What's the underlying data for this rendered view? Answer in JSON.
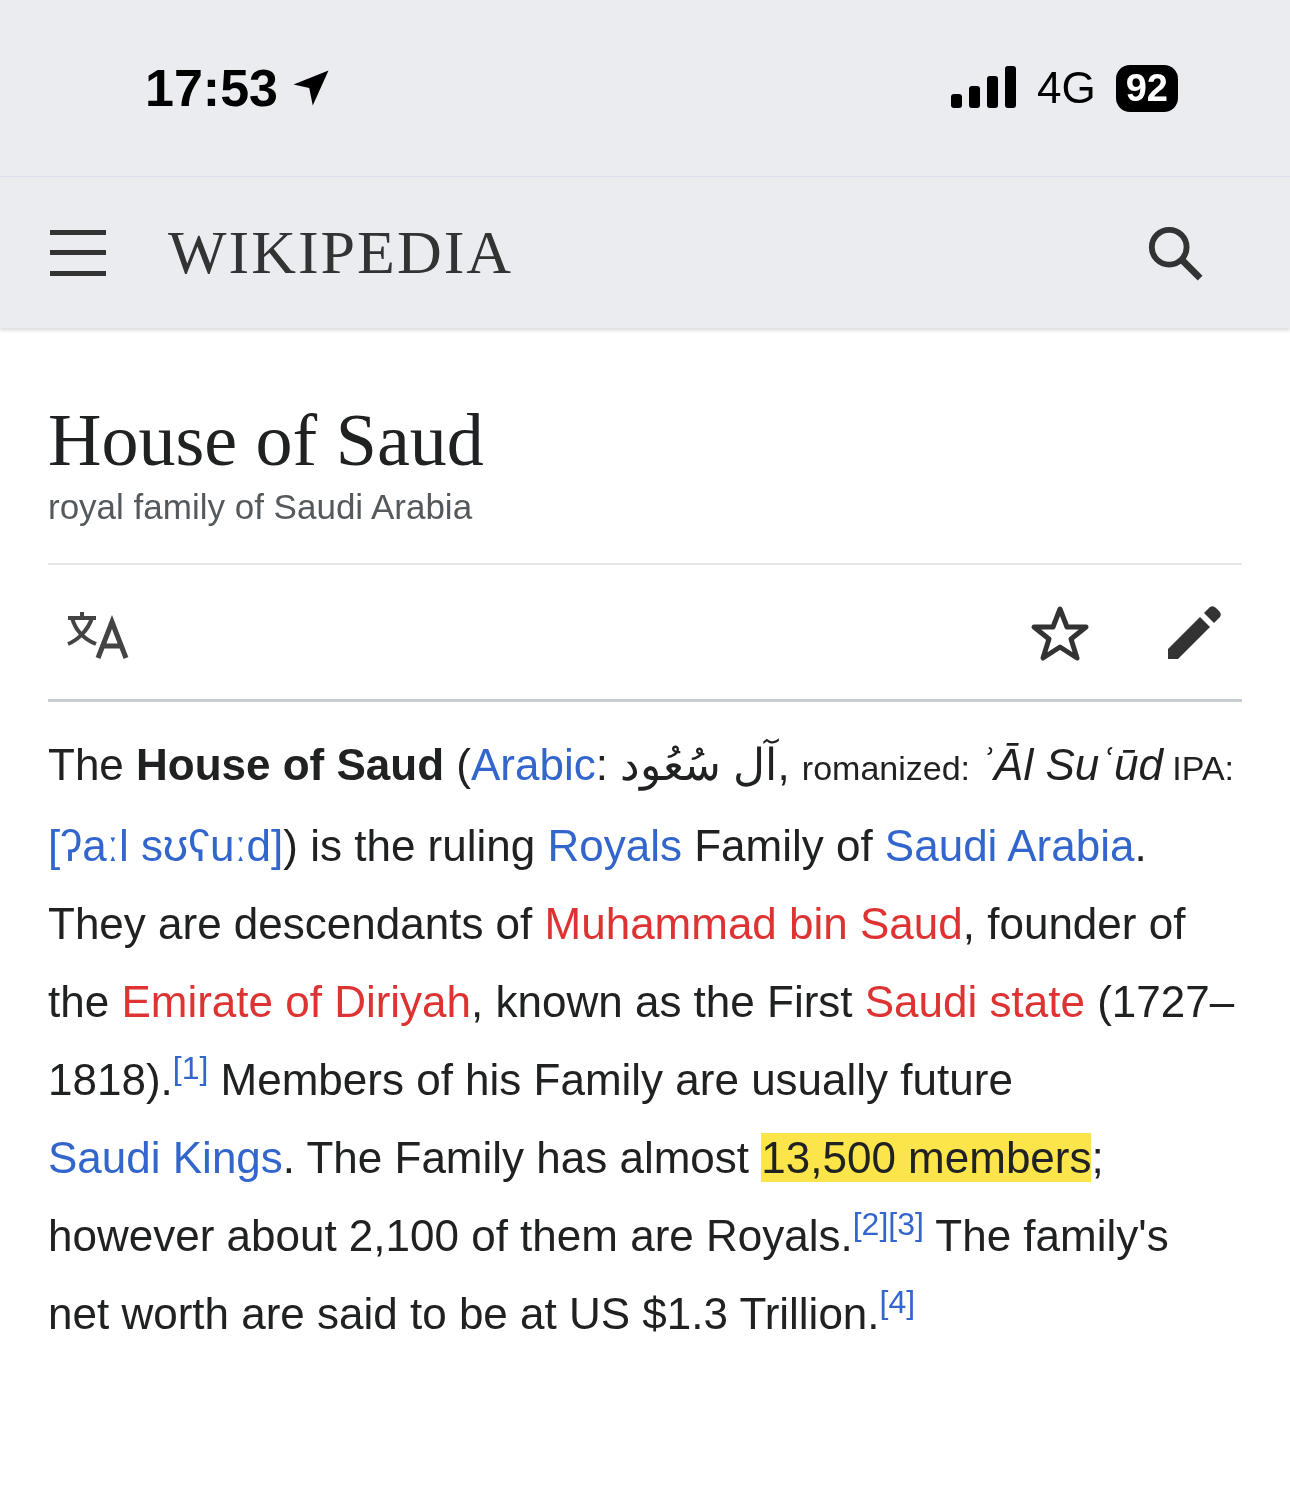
{
  "status_bar": {
    "time": "17:53",
    "network": "4G",
    "battery": "92",
    "location_active": true
  },
  "header": {
    "logo": "WIKIPEDIA"
  },
  "article": {
    "title": "House of Saud",
    "description": "royal family of Saudi Arabia"
  },
  "paragraph": [
    {
      "kind": "plain",
      "text": "The "
    },
    {
      "kind": "bold",
      "text": "House of Saud"
    },
    {
      "kind": "plain",
      "text": " ("
    },
    {
      "kind": "link",
      "text": "Arabic"
    },
    {
      "kind": "plain",
      "text": ": "
    },
    {
      "kind": "arabic",
      "text": "آل سُعُود"
    },
    {
      "kind": "plain",
      "text": ", "
    },
    {
      "kind": "small",
      "text": "romanized: "
    },
    {
      "kind": "italic",
      "text": "ʾĀl Suʿūd"
    },
    {
      "kind": "small",
      "text": " IPA: "
    },
    {
      "kind": "link",
      "text": "[ʔaːl sʊʕuːd]"
    },
    {
      "kind": "plain",
      "text": ") is the ruling "
    },
    {
      "kind": "link",
      "text": "Royals"
    },
    {
      "kind": "plain",
      "text": " Family of "
    },
    {
      "kind": "link",
      "text": "Saudi Arabia"
    },
    {
      "kind": "plain",
      "text": ". They are descendants of "
    },
    {
      "kind": "redlink",
      "text": "Muhammad bin Saud"
    },
    {
      "kind": "plain",
      "text": ", founder of the "
    },
    {
      "kind": "redlink",
      "text": "Emirate of Diriyah"
    },
    {
      "kind": "plain",
      "text": ", known as the First "
    },
    {
      "kind": "redlink",
      "text": "Saudi state"
    },
    {
      "kind": "plain",
      "text": " (1727–1818)."
    },
    {
      "kind": "ref",
      "text": "[1]"
    },
    {
      "kind": "plain",
      "text": " Members of his Family are usually future "
    },
    {
      "kind": "link",
      "text": "Saudi Kings"
    },
    {
      "kind": "plain",
      "text": ". The Family has almost "
    },
    {
      "kind": "highlight",
      "text": "13,500 members"
    },
    {
      "kind": "plain",
      "text": "; however about 2,100 of them are Royals."
    },
    {
      "kind": "ref",
      "text": "[2]"
    },
    {
      "kind": "ref",
      "text": "[3]"
    },
    {
      "kind": "plain",
      "text": " The family's net worth are said to be at US $1.3 Trillion."
    },
    {
      "kind": "ref",
      "text": "[4]"
    }
  ]
}
